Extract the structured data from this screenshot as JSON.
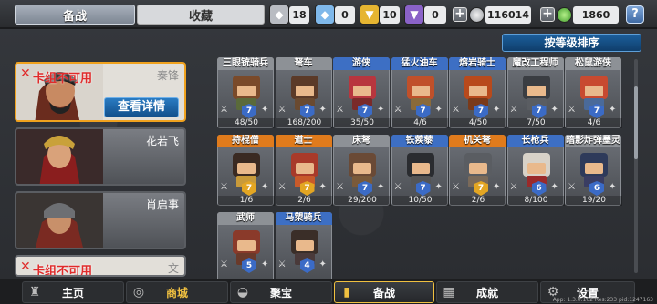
{
  "header": {
    "tab_active": "备战",
    "tab_inactive": "收藏",
    "resources": [
      {
        "icon": "silver-shard-icon",
        "value": "18",
        "color": "#b9bcc2"
      },
      {
        "icon": "blue-gem-icon",
        "value": "0",
        "color": "#7fb8ea"
      },
      {
        "icon": "gold-shield-icon",
        "value": "10",
        "color": "#e6b531"
      },
      {
        "icon": "purple-shield-icon",
        "value": "0",
        "color": "#8a62c8"
      }
    ],
    "silver_coins": "116014",
    "green_coins": "1860",
    "help": "?"
  },
  "sort_button": "按等级排序",
  "heroes": [
    {
      "name": "秦锋",
      "status": "卡组不可用",
      "detail_button": "查看详情"
    },
    {
      "name": "花若飞"
    },
    {
      "name": "肖启事"
    },
    {
      "name": "文",
      "status": "卡组不可用"
    }
  ],
  "units": [
    {
      "title": "三眼铳骑兵",
      "level": "7",
      "count": "48/50",
      "rarity": "grey"
    },
    {
      "title": "弩车",
      "level": "7",
      "count": "168/200",
      "rarity": "grey"
    },
    {
      "title": "游侠",
      "level": "7",
      "count": "35/50",
      "rarity": "blue"
    },
    {
      "title": "猛火油车",
      "level": "7",
      "count": "4/6",
      "rarity": "blue"
    },
    {
      "title": "熔岩骑士",
      "level": "7",
      "count": "4/50",
      "rarity": "blue"
    },
    {
      "title": "魔改工程师",
      "level": "7",
      "count": "7/50",
      "rarity": "grey"
    },
    {
      "title": "松鼠游侠",
      "level": "7",
      "count": "4/6",
      "rarity": "grey"
    },
    {
      "title": "持棍僧",
      "level": "7",
      "count": "1/6",
      "rarity": "orange"
    },
    {
      "title": "道士",
      "level": "7",
      "count": "2/6",
      "rarity": "orange"
    },
    {
      "title": "床弩",
      "level": "7",
      "count": "29/200",
      "rarity": "grey"
    },
    {
      "title": "铁蒺藜",
      "level": "7",
      "count": "10/50",
      "rarity": "blue"
    },
    {
      "title": "机关弩",
      "level": "7",
      "count": "2/6",
      "rarity": "orange"
    },
    {
      "title": "长枪兵",
      "level": "6",
      "count": "8/100",
      "rarity": "blue"
    },
    {
      "title": "暗影炸弹墨灵",
      "level": "6",
      "count": "19/20",
      "rarity": "grey"
    },
    {
      "title": "武师",
      "level": "5",
      "count": "",
      "rarity": "grey"
    },
    {
      "title": "马槊骑兵",
      "level": "4",
      "count": "",
      "rarity": "blue"
    }
  ],
  "nav": [
    {
      "label": "主页",
      "icon": "castle-icon"
    },
    {
      "label": "商城",
      "icon": "coins-icon"
    },
    {
      "label": "聚宝",
      "icon": "treasure-bowl-icon"
    },
    {
      "label": "备战",
      "icon": "cards-icon"
    },
    {
      "label": "成就",
      "icon": "trophy-icon"
    },
    {
      "label": "设置",
      "icon": "gear-icon"
    }
  ],
  "version": "App: 1.3.0.162 Res:233 pid:1247163"
}
